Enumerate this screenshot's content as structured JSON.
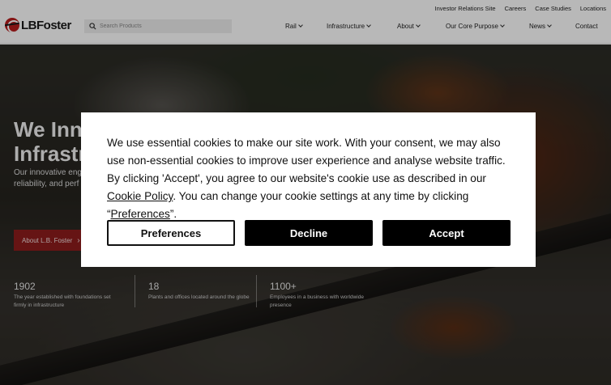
{
  "header": {
    "logo_text": "LBFoster",
    "utility_links": [
      "Investor Relations Site",
      "Careers",
      "Case Studies",
      "Locations"
    ],
    "search_placeholder": "Search Products",
    "nav": [
      {
        "label": "Rail",
        "dropdown": true
      },
      {
        "label": "Infrastructure",
        "dropdown": true
      },
      {
        "label": "About",
        "dropdown": true
      },
      {
        "label": "Our Core Purpose",
        "dropdown": true
      },
      {
        "label": "News",
        "dropdown": true
      },
      {
        "label": "Contact",
        "dropdown": false
      }
    ]
  },
  "hero": {
    "title_line1": "We Inno",
    "title_line2": "Infrastr",
    "subtitle_line1": "Our innovative eng",
    "subtitle_line2": "reliability, and perf",
    "cta_label": "About L.B. Foster",
    "stats": [
      {
        "value": "1902",
        "desc": "The year established with foundations set firmly in infrastructure"
      },
      {
        "value": "18",
        "desc": "Plants and offices located around the globe"
      },
      {
        "value": "1100+",
        "desc": "Employees in a business with worldwide presence"
      }
    ]
  },
  "cookie_banner": {
    "text_part1": "We use essential cookies to make our site work. With your consent, we may also use non-essential cookies to improve user experience and analyse website traffic. By clicking 'Accept', you agree to our website's cookie use as described in our ",
    "policy_link": "Cookie Policy",
    "text_part2": ". You can change your cookie settings at any time by clicking “",
    "preferences_link": "Preferences",
    "text_part3": "”.",
    "buttons": {
      "preferences": "Preferences",
      "decline": "Decline",
      "accept": "Accept"
    }
  },
  "colors": {
    "brand_red": "#8e1d1d",
    "button_black": "#000000"
  }
}
